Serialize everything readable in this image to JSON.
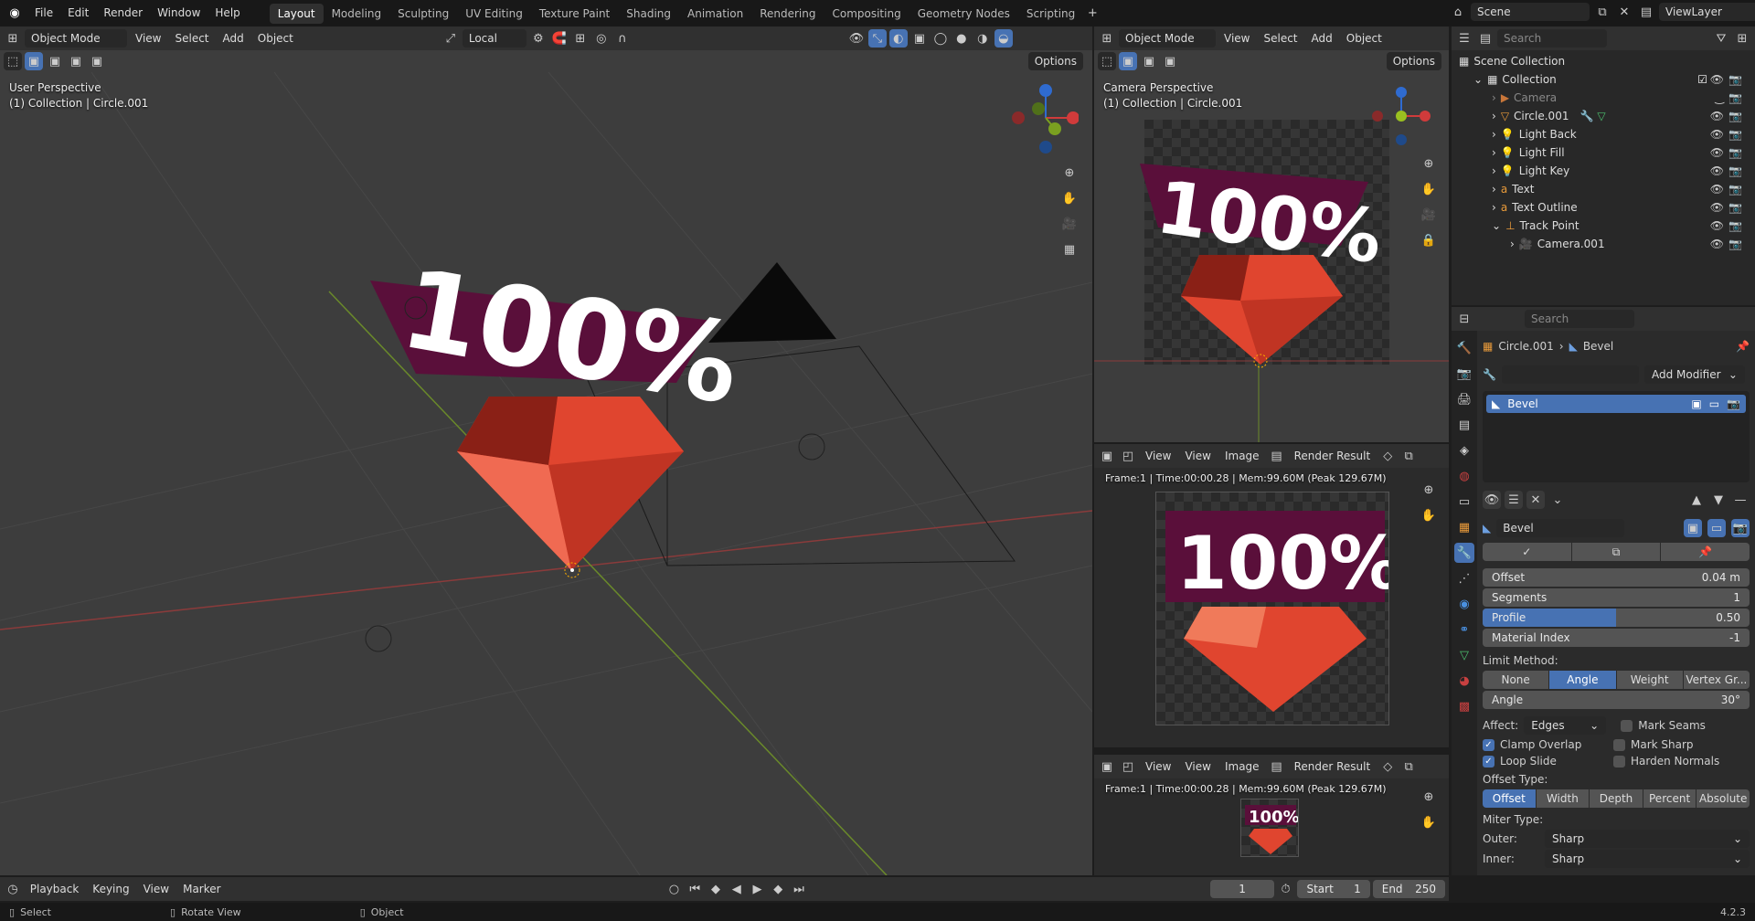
{
  "menus": [
    "File",
    "Edit",
    "Render",
    "Window",
    "Help"
  ],
  "workspaces": [
    "Layout",
    "Modeling",
    "Sculpting",
    "UV Editing",
    "Texture Paint",
    "Shading",
    "Animation",
    "Rendering",
    "Compositing",
    "Geometry Nodes",
    "Scripting"
  ],
  "scene": {
    "label": "Scene",
    "view_layer": "ViewLayer"
  },
  "viewport_main": {
    "mode": "Object Mode",
    "menus": [
      "View",
      "Select",
      "Add",
      "Object"
    ],
    "transform": "Local",
    "options": "Options",
    "title": "User Perspective",
    "subtitle": "(1) Collection | Circle.001",
    "text_3d": "100%"
  },
  "viewport_camera": {
    "mode": "Object Mode",
    "menus": [
      "View",
      "Select",
      "Add",
      "Object"
    ],
    "options": "Options",
    "title": "Camera Perspective",
    "subtitle": "(1) Collection | Circle.001",
    "text_3d": "100%"
  },
  "image_editor_1": {
    "menus": [
      "View",
      "View",
      "Image"
    ],
    "image": "Render Result",
    "info": "Frame:1 | Time:00:00.28 | Mem:99.60M (Peak 129.67M)",
    "text_3d": "100%"
  },
  "image_editor_2": {
    "menus": [
      "View",
      "View",
      "Image"
    ],
    "image": "Render Result",
    "info": "Frame:1 | Time:00:00.28 | Mem:99.60M (Peak 129.67M)",
    "text_3d": "100%"
  },
  "outliner": {
    "search_placeholder": "Search",
    "items": [
      {
        "label": "Scene Collection",
        "depth": 0
      },
      {
        "label": "Collection",
        "depth": 1
      },
      {
        "label": "Camera",
        "depth": 2
      },
      {
        "label": "Circle.001",
        "depth": 2
      },
      {
        "label": "Light Back",
        "depth": 2
      },
      {
        "label": "Light Fill",
        "depth": 2
      },
      {
        "label": "Light Key",
        "depth": 2
      },
      {
        "label": "Text",
        "depth": 2
      },
      {
        "label": "Text Outline",
        "depth": 2
      },
      {
        "label": "Track Point",
        "depth": 2
      },
      {
        "label": "Camera.001",
        "depth": 3
      }
    ]
  },
  "properties": {
    "search_placeholder": "Search",
    "breadcrumb_object": "Circle.001",
    "breadcrumb_modifier": "Bevel",
    "add_modifier": "Add Modifier",
    "modifier_list_item": "Bevel",
    "modifier_name": "Bevel",
    "fields": [
      {
        "label": "Offset",
        "value": "0.04 m"
      },
      {
        "label": "Segments",
        "value": "1"
      },
      {
        "label": "Profile",
        "value": "0.50",
        "fill": 0.5
      },
      {
        "label": "Material Index",
        "value": "-1"
      }
    ],
    "limit_method_label": "Limit Method:",
    "limit_methods": [
      "None",
      "Angle",
      "Weight",
      "Vertex Gr..."
    ],
    "limit_active": "Angle",
    "angle": {
      "label": "Angle",
      "value": "30°"
    },
    "affect_label": "Affect:",
    "affect_value": "Edges",
    "checks": [
      {
        "label": "Mark Seams",
        "on": false
      },
      {
        "label": "Clamp Overlap",
        "on": true
      },
      {
        "label": "Mark Sharp",
        "on": false
      },
      {
        "label": "Loop Slide",
        "on": true
      },
      {
        "label": "Harden Normals",
        "on": false
      }
    ],
    "offset_type_label": "Offset Type:",
    "offset_types": [
      "Offset",
      "Width",
      "Depth",
      "Percent",
      "Absolute"
    ],
    "offset_active": "Offset",
    "miter_label": "Miter Type:",
    "outer_label": "Outer:",
    "outer_value": "Sharp",
    "inner_label": "Inner:",
    "inner_value": "Sharp"
  },
  "timeline": {
    "menus": [
      "Playback",
      "Keying",
      "View",
      "Marker"
    ],
    "frame": "1",
    "start_label": "Start",
    "start": "1",
    "end_label": "End",
    "end": "250"
  },
  "statusbar": {
    "select": "Select",
    "rotate": "Rotate View",
    "object": "Object",
    "version": "4.2.3"
  },
  "colors": {
    "accent": "#4772b3",
    "gem": "#e0452f",
    "banner": "#5a0f3a"
  }
}
